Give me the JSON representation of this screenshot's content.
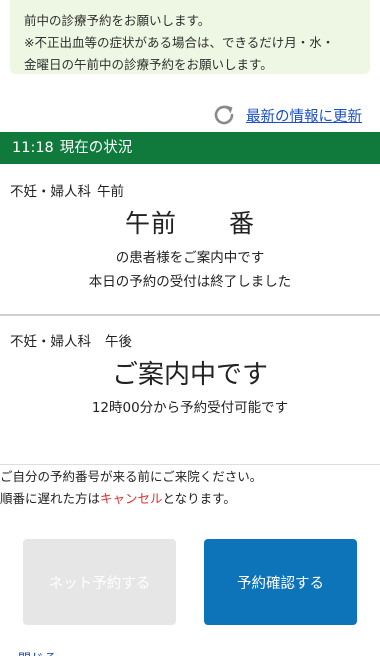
{
  "notice": {
    "line1": "前中の診療予約をお願いします。",
    "line2": "※不正出血等の症状がある場合は、できるだけ月・水・",
    "line3": "金曜日の午前中の診療予約をお願いします。"
  },
  "refresh": {
    "icon": "refresh-icon",
    "label": "最新の情報に更新"
  },
  "status": {
    "time": "11:18",
    "label": "現在の状況",
    "color": "#0f7a3c"
  },
  "departments": [
    {
      "name": "不妊・婦人科",
      "session": "午前",
      "number_prefix": "午前",
      "number_value": "",
      "number_suffix": "番",
      "line1": "の患者様をご案内中です",
      "line2": "本日の予約の受付は終了しました"
    },
    {
      "name": "不妊・婦人科",
      "session": "午後",
      "headline": "ご案内中です",
      "line1": "12時00分から予約受付可能です"
    }
  ],
  "info": {
    "line1": "ご自分の予約番号が来る前にご来院ください。",
    "line2_before": "順番に遅れた方は",
    "line2_highlight": "キャンセル",
    "line2_after": "となります。",
    "highlight_color": "#e03030"
  },
  "buttons": {
    "net_reserve": "ネット予約する",
    "confirm_reserve": "予約確認する",
    "confirm_color": "#0e74b9"
  },
  "footer_cut": "閉じる"
}
